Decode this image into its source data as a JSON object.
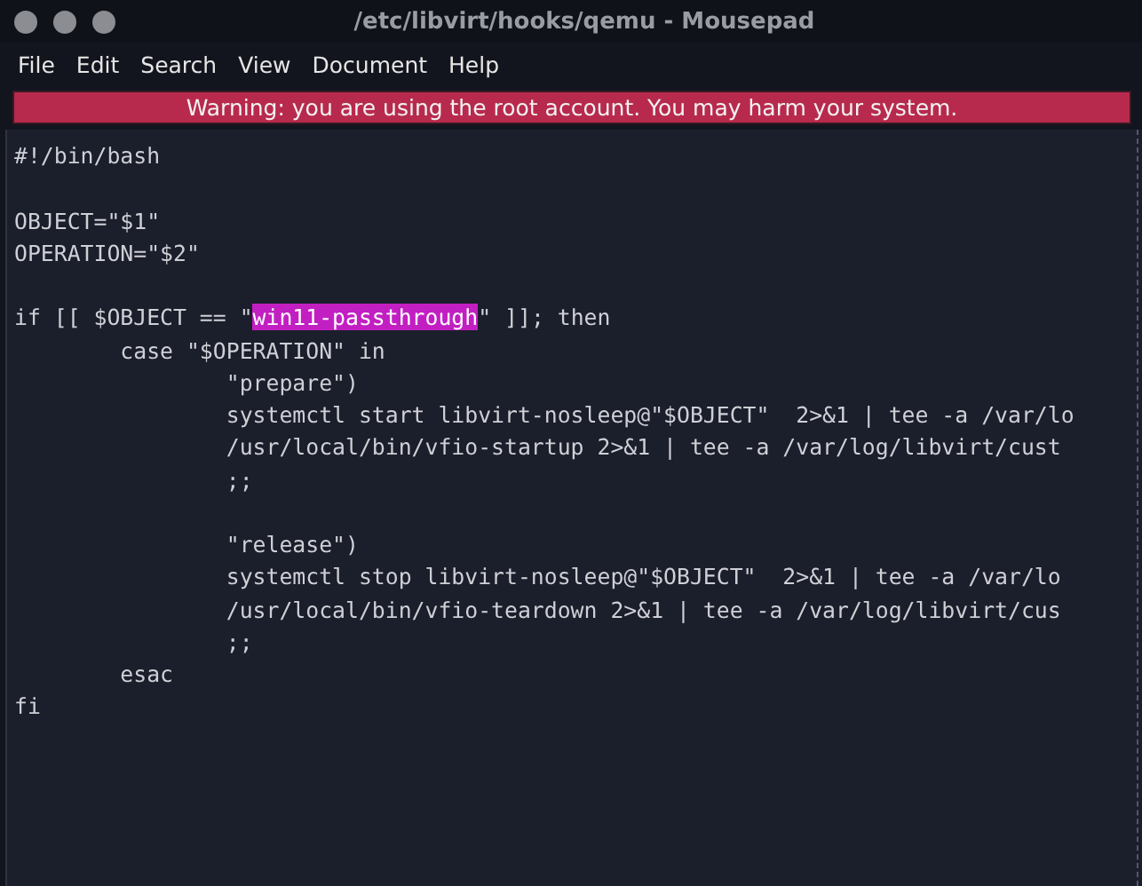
{
  "window": {
    "title": "/etc/libvirt/hooks/qemu - Mousepad"
  },
  "menu": [
    "File",
    "Edit",
    "Search",
    "View",
    "Document",
    "Help"
  ],
  "warning": "Warning: you are using the root account. You may harm your system.",
  "editor": {
    "lines": [
      {
        "kind": "code",
        "parts": [
          {
            "text": "#!/bin/bash",
            "selected": false
          }
        ]
      },
      {
        "kind": "blank"
      },
      {
        "kind": "code",
        "parts": [
          {
            "text": "OBJECT=\"$1\"",
            "selected": false
          }
        ]
      },
      {
        "kind": "code",
        "parts": [
          {
            "text": "OPERATION=\"$2\"",
            "selected": false
          }
        ]
      },
      {
        "kind": "blank"
      },
      {
        "kind": "code",
        "parts": [
          {
            "text": "if [[ $OBJECT == \"",
            "selected": false
          },
          {
            "text": "win11-passthrough",
            "selected": true
          },
          {
            "text": "\" ]]; then",
            "selected": false
          }
        ]
      },
      {
        "kind": "code",
        "parts": [
          {
            "text": "        case \"$OPERATION\" in",
            "selected": false
          }
        ]
      },
      {
        "kind": "code",
        "parts": [
          {
            "text": "                \"prepare\")",
            "selected": false
          }
        ]
      },
      {
        "kind": "code",
        "parts": [
          {
            "text": "                systemctl start libvirt-nosleep@\"$OBJECT\"  2>&1 | tee -a /var/lo",
            "selected": false
          }
        ]
      },
      {
        "kind": "code",
        "parts": [
          {
            "text": "                /usr/local/bin/vfio-startup 2>&1 | tee -a /var/log/libvirt/cust",
            "selected": false
          }
        ]
      },
      {
        "kind": "code",
        "parts": [
          {
            "text": "                ;;",
            "selected": false
          }
        ]
      },
      {
        "kind": "blank"
      },
      {
        "kind": "code",
        "parts": [
          {
            "text": "                \"release\")",
            "selected": false
          }
        ]
      },
      {
        "kind": "code",
        "parts": [
          {
            "text": "                systemctl stop libvirt-nosleep@\"$OBJECT\"  2>&1 | tee -a /var/lo",
            "selected": false
          }
        ]
      },
      {
        "kind": "code",
        "parts": [
          {
            "text": "                /usr/local/bin/vfio-teardown 2>&1 | tee -a /var/log/libvirt/cus",
            "selected": false
          }
        ]
      },
      {
        "kind": "code",
        "parts": [
          {
            "text": "                ;;",
            "selected": false
          }
        ]
      },
      {
        "kind": "code",
        "parts": [
          {
            "text": "        esac",
            "selected": false
          }
        ]
      },
      {
        "kind": "code",
        "parts": [
          {
            "text": "fi",
            "selected": false
          }
        ]
      }
    ]
  }
}
